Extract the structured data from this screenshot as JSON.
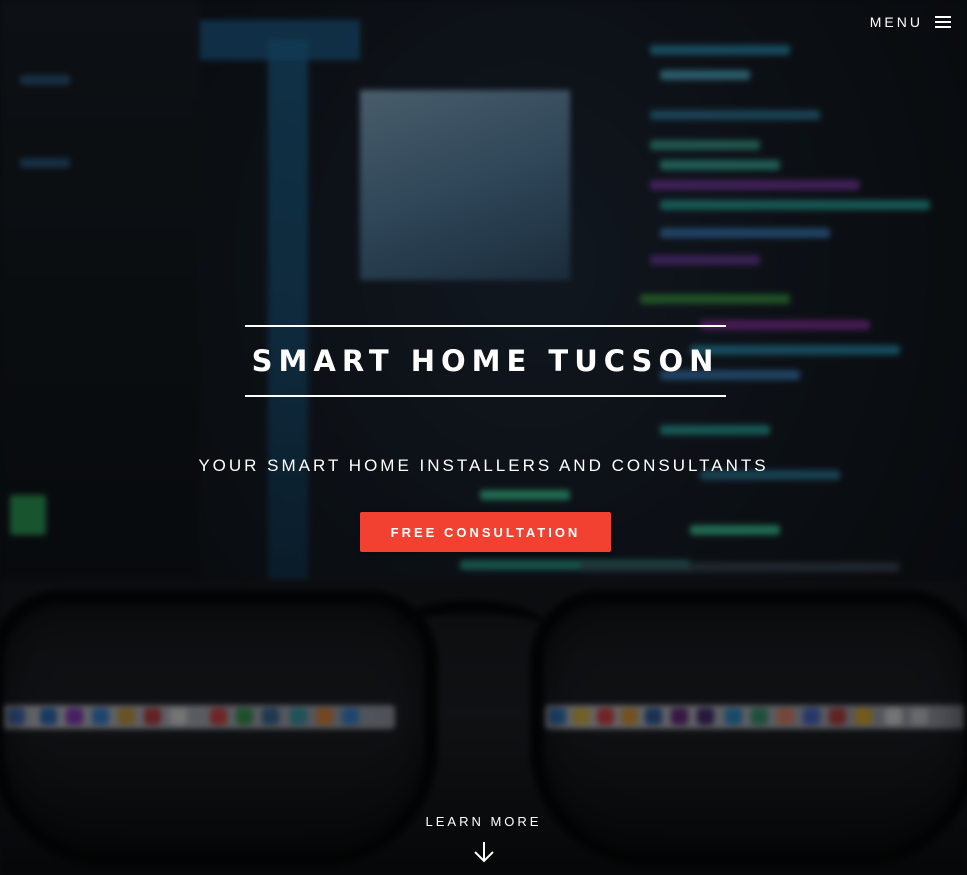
{
  "header": {
    "menu_label": "MENU",
    "menu_icon": "hamburger-icon"
  },
  "hero": {
    "title": "SMART HOME TUCSON",
    "tagline": "YOUR SMART HOME INSTALLERS AND CONSULTANTS",
    "cta_label": "FREE CONSULTATION",
    "learn_more_label": "LEARN MORE",
    "learn_more_icon": "arrow-down-icon"
  },
  "colors": {
    "cta_background": "#f24131",
    "text": "#ffffff",
    "overlay": "#000000"
  }
}
